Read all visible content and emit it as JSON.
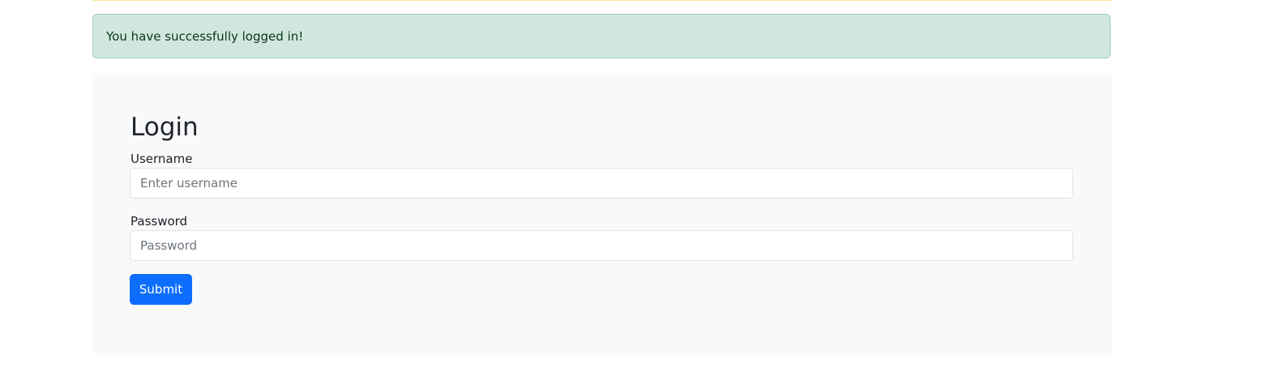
{
  "alert": {
    "message": "You have successfully logged in!"
  },
  "login_form": {
    "title": "Login",
    "username": {
      "label": "Username",
      "placeholder": "Enter username",
      "value": ""
    },
    "password": {
      "label": "Password",
      "placeholder": "Password",
      "value": ""
    },
    "submit_label": "Submit"
  },
  "colors": {
    "success_background": "#d1e7dd",
    "success_text": "#0a3622",
    "card_background": "#f8f9fa",
    "primary_button": "#0d6efd"
  }
}
